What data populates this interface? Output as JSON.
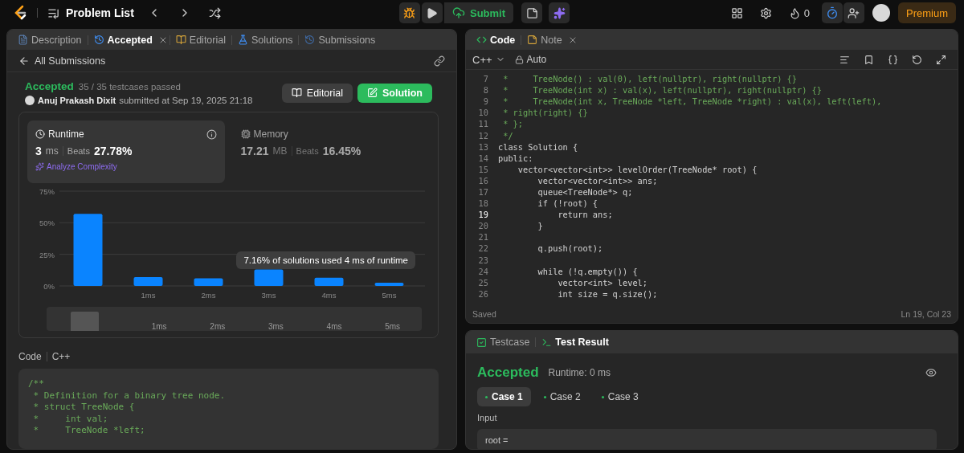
{
  "topbar": {
    "title": "Problem List",
    "submit": "Submit",
    "streak": "0",
    "premium": "Premium"
  },
  "left_tabs": [
    {
      "label": "Description",
      "selected": false,
      "closable": false
    },
    {
      "label": "Accepted",
      "selected": true,
      "closable": true
    },
    {
      "label": "Editorial",
      "selected": false,
      "closable": false
    },
    {
      "label": "Solutions",
      "selected": false,
      "closable": false
    },
    {
      "label": "Submissions",
      "selected": false,
      "closable": false
    }
  ],
  "back_link": "All Submissions",
  "submission": {
    "status": "Accepted",
    "passed": "35 / 35 testcases passed",
    "author": "Anuj Prakash Dixit",
    "submitted": "submitted at Sep 19, 2025 21:18",
    "buttons": [
      {
        "label": "Editorial",
        "kind": "secondary"
      },
      {
        "label": "Solution",
        "kind": "primary"
      }
    ]
  },
  "stats": [
    {
      "title": "Runtime",
      "value": "3",
      "unit": "ms",
      "beats_label": "Beats",
      "beats": "27.78%",
      "selected": true
    },
    {
      "title": "Memory",
      "value": "17.21",
      "unit": "MB",
      "beats_label": "Beats",
      "beats": "16.45%",
      "selected": false
    }
  ],
  "analyze": "Analyze Complexity",
  "chart_data": {
    "type": "bar",
    "x": [
      0,
      1,
      2,
      3,
      4,
      5
    ],
    "series": [
      {
        "color": "#0a84ff",
        "values": [
          57,
          7,
          6,
          13,
          6.5,
          2.5
        ]
      }
    ],
    "xlim": [
      -0.5,
      5.5
    ],
    "xticks": [
      {
        "value": 1,
        "label": "1ms"
      },
      {
        "value": 2,
        "label": "2ms"
      },
      {
        "value": 3,
        "label": "3ms"
      },
      {
        "value": 4,
        "label": "4ms"
      },
      {
        "value": 5,
        "label": "5ms"
      }
    ],
    "ylim": [
      0,
      75
    ],
    "yticks": [
      {
        "value": 0,
        "label": "0%"
      },
      {
        "value": 25,
        "label": "25%"
      },
      {
        "value": 50,
        "label": "50%"
      },
      {
        "value": 75,
        "label": "75%"
      }
    ]
  },
  "tooltip": "7.16% of solutions used 4 ms of runtime",
  "range_labels": [
    "1ms",
    "2ms",
    "3ms",
    "4ms",
    "5ms"
  ],
  "code_preview": {
    "label": "Code",
    "language": "C++",
    "lines": [
      "/**",
      " * Definition for a binary tree node.",
      " * struct TreeNode {",
      " *     int val;",
      " *     TreeNode *left;"
    ]
  },
  "editor": {
    "tabs": [
      {
        "label": "Code",
        "selected": true,
        "closable": false
      },
      {
        "label": "Note",
        "selected": false,
        "closable": true
      }
    ],
    "language": "C++",
    "mode": "Auto",
    "lines": [
      {
        "n": "7",
        "text": " *     TreeNode() : val(0), left(nullptr), right(nullptr) {}",
        "kind": "comment",
        "active": false
      },
      {
        "n": "8",
        "text": " *     TreeNode(int x) : val(x), left(nullptr), right(nullptr) {}",
        "kind": "comment",
        "active": false
      },
      {
        "n": "9",
        "text": " *     TreeNode(int x, TreeNode *left, TreeNode *right) : val(x), left(left),",
        "kind": "comment",
        "active": false
      },
      {
        "n": "10",
        "text": " * right(right) {}",
        "kind": "comment",
        "active": false
      },
      {
        "n": "11",
        "text": " * };",
        "kind": "comment",
        "active": false
      },
      {
        "n": "12",
        "text": " */",
        "kind": "comment",
        "active": false
      },
      {
        "n": "13",
        "text": "class Solution {",
        "kind": "code",
        "active": false
      },
      {
        "n": "14",
        "text": "public:",
        "kind": "code",
        "active": false
      },
      {
        "n": "15",
        "text": "    vector<vector<int>> levelOrder(TreeNode* root) {",
        "kind": "code",
        "active": false
      },
      {
        "n": "16",
        "text": "        vector<vector<int>> ans;",
        "kind": "code",
        "active": false
      },
      {
        "n": "17",
        "text": "        queue<TreeNode*> q;",
        "kind": "code",
        "active": false
      },
      {
        "n": "18",
        "text": "        if (!root) {",
        "kind": "code",
        "active": false
      },
      {
        "n": "19",
        "text": "            return ans;",
        "kind": "code",
        "active": true
      },
      {
        "n": "20",
        "text": "        }",
        "kind": "code",
        "active": false
      },
      {
        "n": "21",
        "kind": "blank",
        "active": false
      },
      {
        "n": "22",
        "text": "        q.push(root);",
        "kind": "code",
        "active": false
      },
      {
        "n": "23",
        "kind": "blank",
        "active": false
      },
      {
        "n": "24",
        "text": "        while (!q.empty()) {",
        "kind": "code",
        "active": false
      },
      {
        "n": "25",
        "text": "            vector<int> level;",
        "kind": "code",
        "active": false
      },
      {
        "n": "26",
        "text": "            int size = q.size();",
        "kind": "code",
        "active": false
      }
    ],
    "status": "Saved",
    "cursor": "Ln 19, Col 23"
  },
  "result": {
    "tabs": [
      {
        "label": "Testcase",
        "selected": false
      },
      {
        "label": "Test Result",
        "selected": true
      }
    ],
    "status": "Accepted",
    "runtime": "Runtime: 0 ms",
    "cases": [
      {
        "label": "Case 1",
        "selected": true
      },
      {
        "label": "Case 2",
        "selected": false
      },
      {
        "label": "Case 3",
        "selected": false
      }
    ],
    "input_label": "Input",
    "input": "root ="
  }
}
